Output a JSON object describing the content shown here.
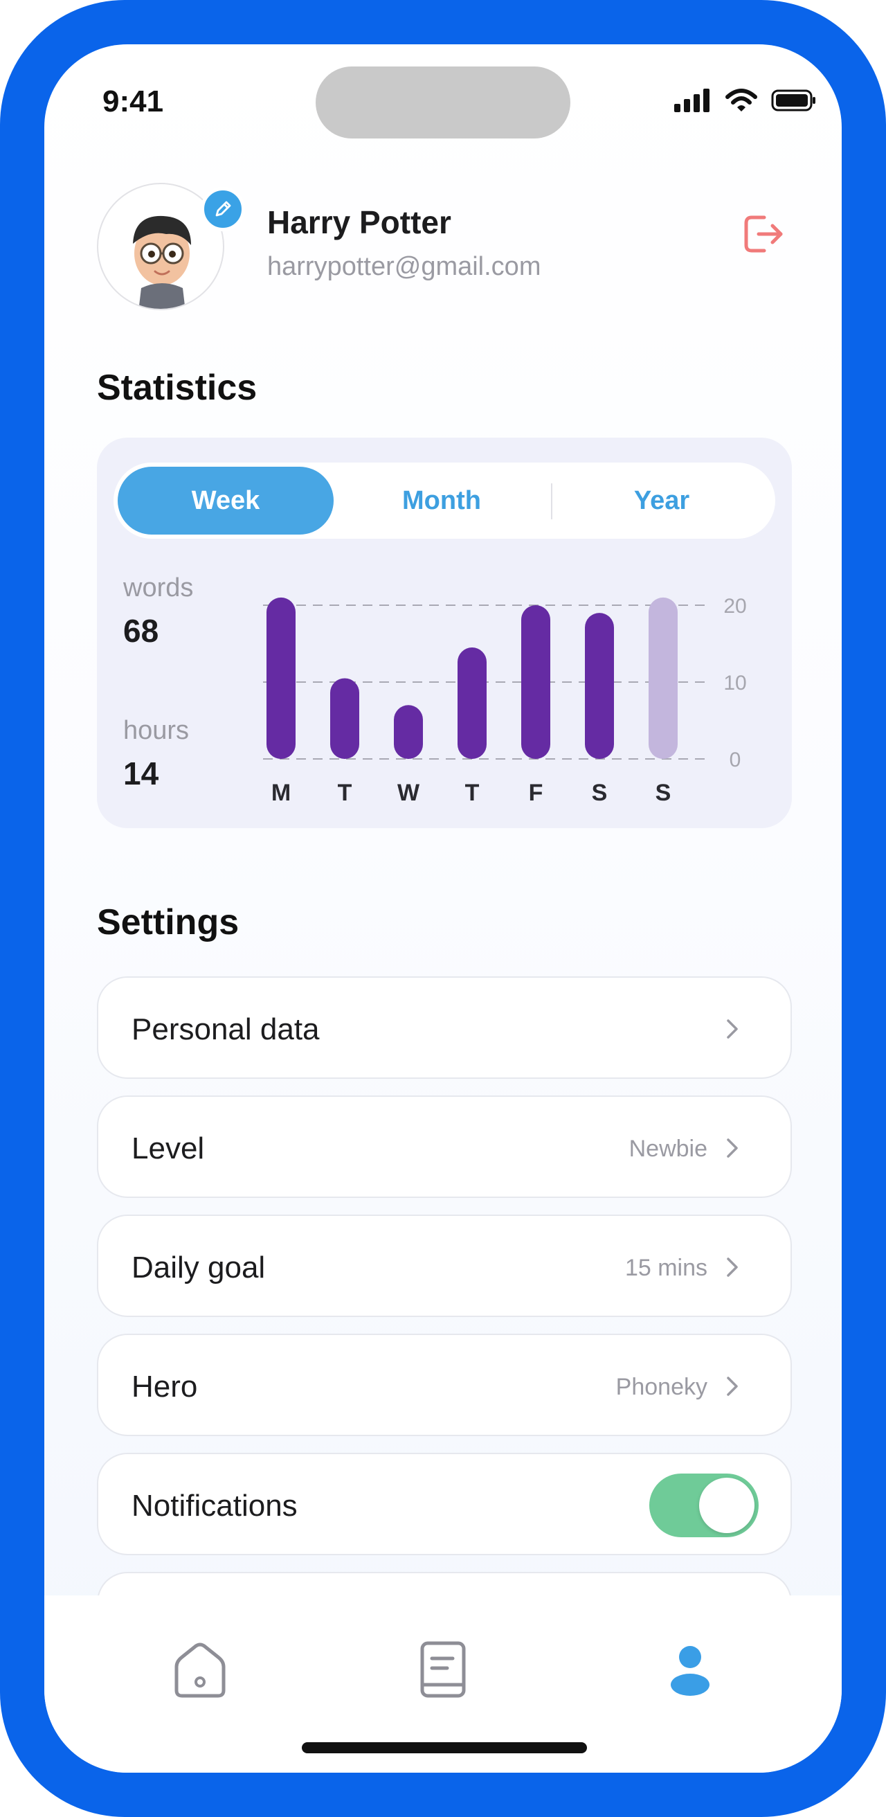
{
  "status_bar": {
    "time": "9:41"
  },
  "profile": {
    "name": "Harry Potter",
    "email": "harrypotter@gmail.com"
  },
  "statistics": {
    "title": "Statistics",
    "tabs": [
      {
        "label": "Week",
        "active": true
      },
      {
        "label": "Month",
        "active": false
      },
      {
        "label": "Year",
        "active": false
      }
    ],
    "words_label": "words",
    "words_value": "68",
    "hours_label": "hours",
    "hours_value": "14"
  },
  "chart_data": {
    "type": "bar",
    "categories": [
      "M",
      "T",
      "W",
      "T",
      "F",
      "S",
      "S"
    ],
    "values": [
      21,
      10.5,
      7,
      14.5,
      20,
      19,
      21
    ],
    "highlight_index": 6,
    "ylim": [
      0,
      20
    ],
    "yticks": [
      "20",
      "10",
      "0"
    ],
    "grid": true,
    "colors": {
      "bar": "#652ba3",
      "bar_light": "#c3b6dd",
      "grid": "#a9a9b4"
    }
  },
  "settings": {
    "title": "Settings",
    "rows": [
      {
        "label": "Personal data",
        "value": ""
      },
      {
        "label": "Level",
        "value": "Newbie"
      },
      {
        "label": "Daily goal",
        "value": "15 mins"
      },
      {
        "label": "Hero",
        "value": "Phoneky"
      },
      {
        "label": "Notifications",
        "toggle": true
      }
    ]
  },
  "tabbar": {
    "items": [
      "home-icon",
      "book-icon",
      "profile-icon"
    ],
    "active": "profile-icon"
  },
  "colors": {
    "accent": "#48a6e4",
    "frame": "#0a64ea",
    "logout": "#f07a7a",
    "toggle_on": "#6fcb98"
  }
}
